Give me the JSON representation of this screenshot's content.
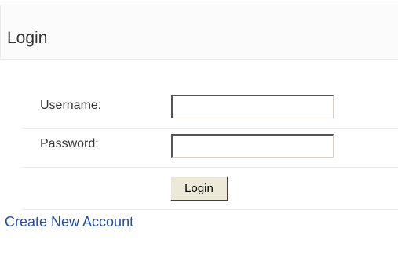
{
  "panel": {
    "title": "Login"
  },
  "form": {
    "username_label": "Username:",
    "username_value": "",
    "password_label": "Password:",
    "password_value": "",
    "submit_label": "Login"
  },
  "links": {
    "create_account": "Create New Account"
  },
  "colors": {
    "link": "#1f4fa8",
    "header_bg": "#fbfbfb",
    "divider": "#ececec",
    "button_face": "#ece9d8"
  }
}
